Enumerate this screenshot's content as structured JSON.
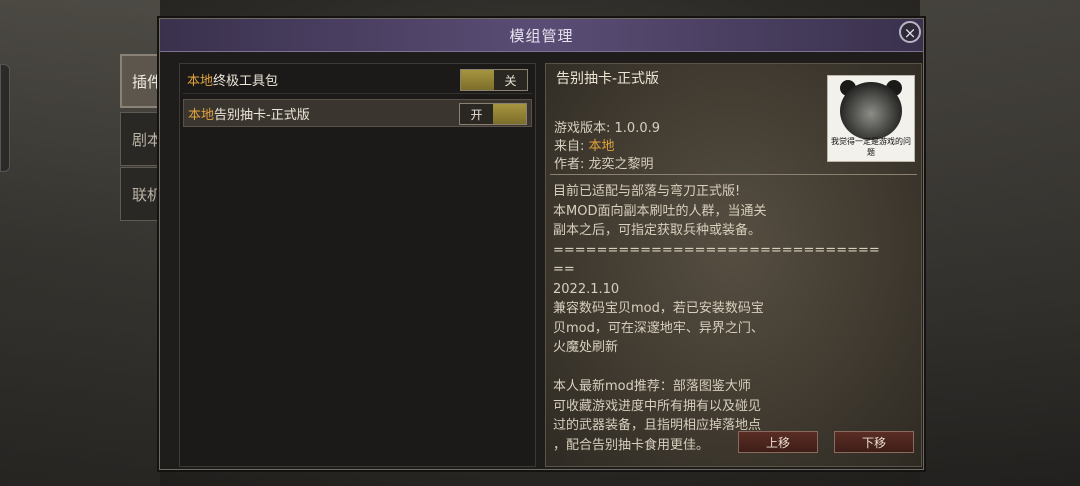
{
  "window": {
    "title": "模组管理",
    "close_glyph": "×"
  },
  "side_tabs": [
    {
      "label": "插件",
      "active": true
    },
    {
      "label": "剧本",
      "active": false
    },
    {
      "label": "联机",
      "active": false
    }
  ],
  "mods": [
    {
      "source": "本地",
      "name": "终极工具包",
      "toggle_label": "关",
      "enabled": false
    },
    {
      "source": "本地",
      "name": "告别抽卡-正式版",
      "toggle_label": "开",
      "enabled": true
    }
  ],
  "detail": {
    "title": "告别抽卡-正式版",
    "version_label": "游戏版本:",
    "version_value": "1.0.0.9",
    "from_label": "来自:",
    "from_value": "本地",
    "author_label": "作者:",
    "author_value": "龙奕之黎明",
    "thumbnail_caption": "我觉得一定是游戏的问题",
    "thumbnail_icon": "panda-meme-icon",
    "description": "目前已适配与部落与弯刀正式版!\n本MOD面向副本刷吐的人群，当通关\n副本之后，可指定获取兵种或装备。\n==============================\n==\n2022.1.10\n兼容数码宝贝mod，若已安装数码宝\n贝mod，可在深邃地牢、异界之门、\n火魔处刷新\n\n本人最新mod推荐：部落图鉴大师\n可收藏游戏进度中所有拥有以及碰见\n过的武器装备，且指明相应掉落地点\n，配合告别抽卡食用更佳。"
  },
  "buttons": {
    "move_up": "上移",
    "move_down": "下移"
  },
  "colors": {
    "title_bar": "#5a4d75",
    "source_tag": "#e0a23b",
    "toggle_on": "#a6953f",
    "move_button": "#5a2d24"
  }
}
